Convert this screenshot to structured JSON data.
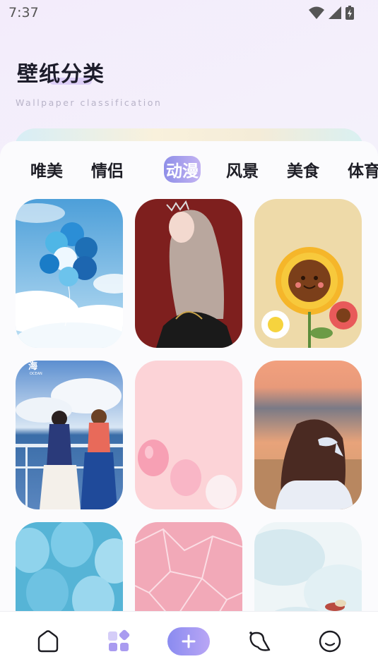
{
  "status": {
    "time": "7:37"
  },
  "header": {
    "title": "壁纸分类",
    "subtitle": "Wallpaper classification"
  },
  "tabs": [
    {
      "label": "唯美",
      "active": false
    },
    {
      "label": "情侣",
      "active": false
    },
    {
      "label": "动漫",
      "active": true
    },
    {
      "label": "风景",
      "active": false
    },
    {
      "label": "美食",
      "active": false
    },
    {
      "label": "体育",
      "active": false
    }
  ],
  "wallpapers": [
    {
      "name": "blue-balloons-sky"
    },
    {
      "name": "girl-long-hair-red"
    },
    {
      "name": "cartoon-sunflowers"
    },
    {
      "name": "two-girls-ocean",
      "caption_cn": "海",
      "caption_en": "OCEAN"
    },
    {
      "name": "pink-balloons"
    },
    {
      "name": "girl-sunset-bow"
    },
    {
      "name": "blue-balloons-closeup"
    },
    {
      "name": "pink-cracked-texture"
    },
    {
      "name": "pale-watercolor"
    }
  ],
  "nav": [
    {
      "name": "home",
      "icon": "home-icon"
    },
    {
      "name": "category",
      "icon": "category-icon",
      "active": true
    },
    {
      "name": "add",
      "icon": "plus-icon"
    },
    {
      "name": "search",
      "icon": "search-icon"
    },
    {
      "name": "profile",
      "icon": "profile-icon"
    }
  ],
  "colors": {
    "accent": "#9a95ee",
    "text": "#1e1e26",
    "nav_active": "#a89af0"
  }
}
